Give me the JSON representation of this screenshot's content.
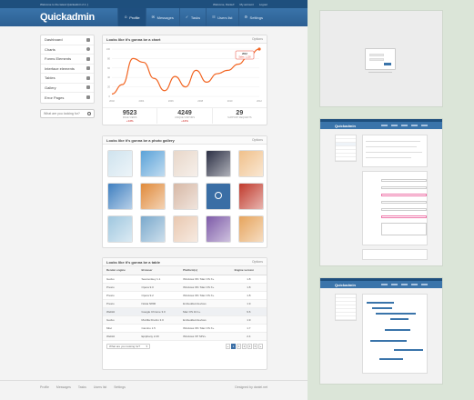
{
  "topbar": {
    "welcome": "Welcome to the latest Quickadmin 2.1 ;)",
    "user_text": "Welcome, Daniel!",
    "account": "My account",
    "logout": "Logout"
  },
  "app": {
    "title": "Quickadmin"
  },
  "nav": [
    {
      "label": "Profile",
      "icon": "user-icon",
      "active": true
    },
    {
      "label": "Messages",
      "icon": "envelope-icon"
    },
    {
      "label": "Tasks",
      "icon": "checklist-icon"
    },
    {
      "label": "Users list",
      "icon": "users-icon"
    },
    {
      "label": "Settings",
      "icon": "gear-icon"
    }
  ],
  "sidebar": {
    "items": [
      {
        "label": "Dashboard",
        "icon": "dashboard-icon"
      },
      {
        "label": "Charts",
        "icon": "pie-chart-icon"
      },
      {
        "label": "Forms Elements",
        "icon": "form-icon"
      },
      {
        "label": "Interface elements",
        "icon": "monitor-icon"
      },
      {
        "label": "Tables",
        "icon": "table-icon"
      },
      {
        "label": "Gallery",
        "icon": "image-icon"
      },
      {
        "label": "Error Pages",
        "icon": "error-icon"
      }
    ],
    "search_placeholder": "What are you looking for?"
  },
  "chart_panel": {
    "title": "Looks like it's gonna be a chart",
    "options": "Options",
    "stats": [
      {
        "value": "9523",
        "label": "PAGE VIEWS",
        "change": "+13%"
      },
      {
        "value": "4249",
        "label": "UNIQUE VISITORS",
        "change": "+13%"
      },
      {
        "value": "29",
        "label": "SUPPORT REQUESTS",
        "change": ""
      }
    ]
  },
  "chart_data": {
    "type": "line",
    "x_ticks": [
      "2002",
      "2004",
      "2006",
      "2008",
      "2010",
      "2012"
    ],
    "y_ticks": [
      "0",
      "20",
      "40",
      "60",
      "80",
      "100"
    ],
    "ylim": [
      0,
      100
    ],
    "series": [
      {
        "values": [
          5,
          25,
          80,
          72,
          38,
          12,
          42,
          20,
          55,
          30,
          48,
          55,
          68,
          85,
          100
        ],
        "color": "#f26522"
      }
    ],
    "tooltip": {
      "title": "2012",
      "text": "Sales: 1,100"
    }
  },
  "gallery_panel": {
    "title": "Looks like it's gonna be a photo gallery",
    "options": "Options",
    "photos": [
      "#cfe3ee",
      "#5aa2d8",
      "#e8d7c9",
      "#2b2f44",
      "#f0c08a",
      "#3e7fc0",
      "#e08a3a",
      "#d7b8a5",
      "#3a6ea5",
      "#c0392b",
      "#9fc7df",
      "#7aa9cc",
      "#e9c8b0",
      "#7d5aa8",
      "#e6a45c"
    ],
    "magnify_icon": "magnify-icon"
  },
  "table_panel": {
    "title": "Looks like it's gonna be a table",
    "options": "Options",
    "columns": [
      "Render engine",
      "Browser",
      "Platform(s)",
      "Engine version"
    ],
    "rows": [
      [
        "Gecko",
        "Seamonkey 1.1",
        "Windows 98 / Mac OS X+",
        "1.8"
      ],
      [
        "Presto",
        "Opera 9.0",
        "Windows 98 / Mac OS X+",
        "1.8"
      ],
      [
        "Presto",
        "Opera 9.2",
        "Windows 98 / Mac OS X+",
        "1.8"
      ],
      [
        "Presto",
        "Nokia N800",
        "Embedded devices",
        "1.9"
      ],
      [
        "Webkit",
        "Google Chrome 3.0",
        "Mac OS 10.1+",
        "9.6"
      ],
      [
        "Gecko",
        "Mozilla Firefox 3.0",
        "Embedded devices",
        "1.9"
      ],
      [
        "Misc",
        "Camino 1.5",
        "Windows 98 / Mac OS X+",
        "1.7"
      ],
      [
        "Webkit",
        "Epiphany 2.20",
        "Windows XP SP2+",
        "2.4"
      ]
    ],
    "footer_select": "What are you looking for?",
    "pages": [
      "«",
      "1",
      "2",
      "3",
      "4",
      "5",
      "»"
    ]
  },
  "footer": {
    "links": [
      "Profile",
      "Messages",
      "Tasks",
      "Users list",
      "Settings"
    ],
    "credit": "Designed by daniel.net"
  },
  "thumbs": {
    "t2_logo": "Quickadmin",
    "t3_logo": "Quickadmin"
  }
}
